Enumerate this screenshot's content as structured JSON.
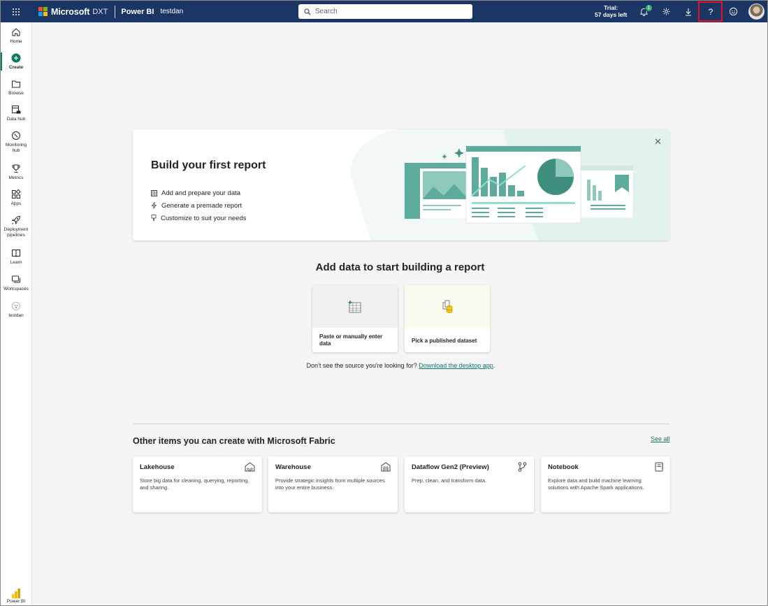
{
  "topbar": {
    "brand": "Microsoft",
    "brand_suffix": "DXT",
    "product": "Power BI",
    "workspace": "testdan",
    "search_placeholder": "Search",
    "trial_line1": "Trial:",
    "trial_line2": "57 days left",
    "notification_count": "1",
    "colors": {
      "background": "#1b3664",
      "highlight": "#e81123"
    }
  },
  "leftnav": {
    "items": [
      {
        "label": "Home",
        "icon": "home-icon"
      },
      {
        "label": "Create",
        "icon": "create-icon",
        "active": true
      },
      {
        "label": "Browse",
        "icon": "folder-icon"
      },
      {
        "label": "Data hub",
        "icon": "data-hub-icon"
      },
      {
        "label": "Monitoring hub",
        "icon": "monitoring-icon"
      },
      {
        "label": "Metrics",
        "icon": "trophy-icon"
      },
      {
        "label": "Apps",
        "icon": "apps-icon"
      },
      {
        "label": "Deployment pipelines",
        "icon": "rocket-icon"
      },
      {
        "label": "Learn",
        "icon": "book-icon"
      },
      {
        "label": "Workspaces",
        "icon": "workspaces-icon"
      },
      {
        "label": "testdan",
        "icon": "workspace-avatar-icon"
      }
    ],
    "footer_label": "Power BI",
    "accent": "#117865"
  },
  "hero": {
    "title": "Build your first report",
    "items": [
      {
        "label": "Add and prepare your data",
        "icon": "table-icon"
      },
      {
        "label": "Generate a premade report",
        "icon": "lightning-icon"
      },
      {
        "label": "Customize to suit your needs",
        "icon": "paintbrush-icon"
      }
    ]
  },
  "add_data": {
    "title": "Add data to start building a report",
    "cards": [
      {
        "label": "Paste or manually enter data",
        "icon": "table-add-icon"
      },
      {
        "label": "Pick a published dataset",
        "icon": "dataset-icon"
      }
    ],
    "prompt": "Don't see the source you're looking for?",
    "link": "Download the desktop app",
    "link_suffix": "."
  },
  "fabric": {
    "title": "Other items you can create with Microsoft Fabric",
    "see_all": "See all",
    "cards": [
      {
        "title": "Lakehouse",
        "desc": "Store big data for cleaning, querying, reporting, and sharing.",
        "icon": "lakehouse-icon"
      },
      {
        "title": "Warehouse",
        "desc": "Provide strategic insights from multiple sources into your entire business.",
        "icon": "warehouse-icon"
      },
      {
        "title": "Dataflow Gen2 (Preview)",
        "desc": "Prep, clean, and transform data.",
        "icon": "dataflow-icon"
      },
      {
        "title": "Notebook",
        "desc": "Explore data and build machine learning solutions with Apache Spark applications.",
        "icon": "notebook-icon"
      }
    ]
  }
}
